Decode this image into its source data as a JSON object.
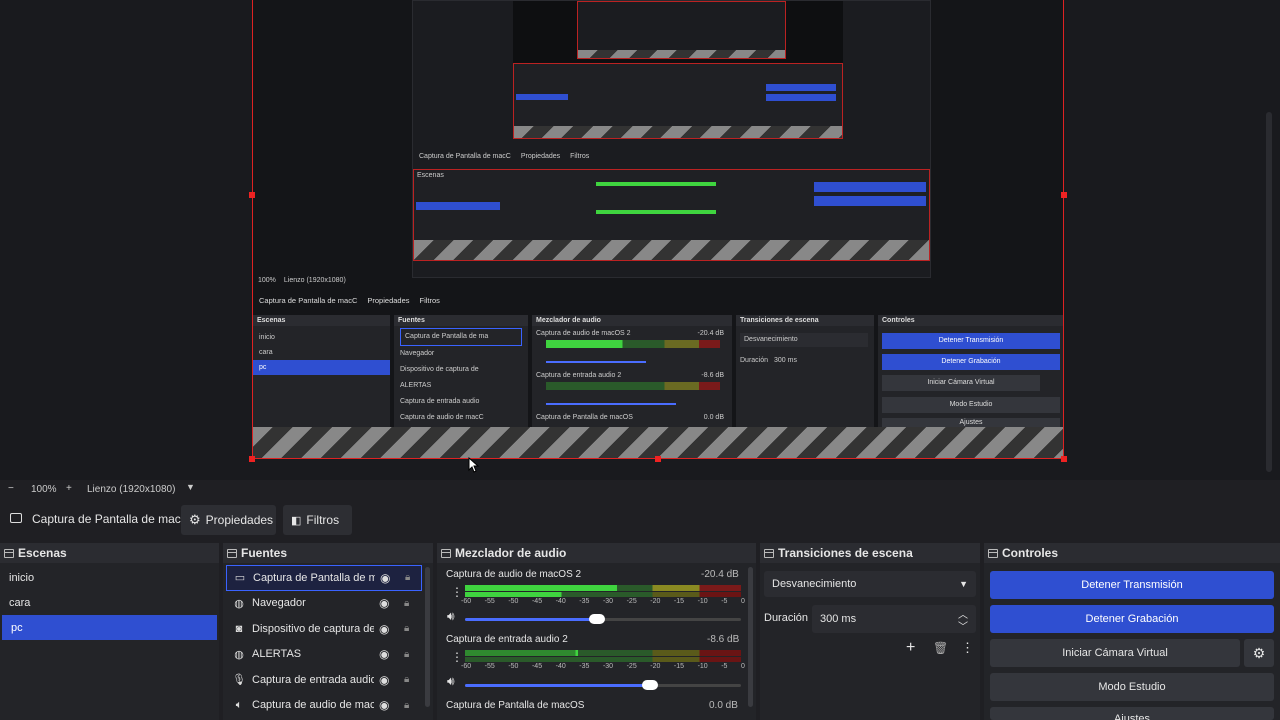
{
  "preview": {
    "zoom": "100%",
    "canvas_label": "Lienzo (1920x1080)",
    "mini": {
      "zoom": "100%",
      "canvas_label": "Lienzo (1920x1080)",
      "source_name": "Captura de Pantalla de macC",
      "props": "Propiedades",
      "filters": "Filtros",
      "scenes_title": "Escenas",
      "scenes": [
        "inicio",
        "cara",
        "pc"
      ],
      "sources_title": "Fuentes",
      "sources": [
        "Captura de Pantalla de ma",
        "Navegador",
        "Dispositivo de captura de",
        "ALERTAS",
        "Captura de entrada audio",
        "Captura de audio de macC"
      ],
      "mixer_title": "Mezclador de audio",
      "mixer": [
        {
          "name": "Captura de audio de macOS 2",
          "db": "-20.4 dB"
        },
        {
          "name": "Captura de entrada audio 2",
          "db": "-8.6 dB"
        },
        {
          "name": "Captura de Pantalla de macOS",
          "db": "0.0 dB"
        }
      ],
      "transitions_title": "Transiciones de escena",
      "transition": "Desvanecimiento",
      "duration_label": "Duración",
      "duration": "300 ms",
      "controls_title": "Controles",
      "controls": [
        "Detener Transmisión",
        "Detener Grabación",
        "Iniciar Cámara Virtual",
        "Modo Estudio",
        "Ajustes"
      ]
    }
  },
  "zoombar": {
    "minus": "−",
    "zoom": "100%",
    "plus": "+",
    "canvas": "Lienzo (1920x1080)"
  },
  "propbar": {
    "source_name": "Captura de Pantalla de macC",
    "properties": "Propiedades",
    "filters": "Filtros"
  },
  "scenes": {
    "title": "Escenas",
    "items": [
      "inicio",
      "cara",
      "pc"
    ],
    "selected": 2
  },
  "sources": {
    "title": "Fuentes",
    "items": [
      {
        "label": "Captura de Pantalla de ma",
        "icon": "monitor-icon"
      },
      {
        "label": "Navegador",
        "icon": "globe-icon"
      },
      {
        "label": "Dispositivo de captura de",
        "icon": "camera-icon"
      },
      {
        "label": "ALERTAS",
        "icon": "globe-icon"
      },
      {
        "label": "Captura de entrada audio",
        "icon": "microphone-icon"
      },
      {
        "label": "Captura de audio de macC",
        "icon": "speaker-icon"
      }
    ]
  },
  "mixer": {
    "title": "Mezclador de audio",
    "ticks": [
      "-60",
      "-55",
      "-50",
      "-45",
      "-40",
      "-35",
      "-30",
      "-25",
      "-20",
      "-15",
      "-10",
      "-5",
      "0"
    ],
    "channels": [
      {
        "name": "Captura de audio de macOS 2",
        "db": "-20.4 dB",
        "volume": 0.48
      },
      {
        "name": "Captura de entrada audio 2",
        "db": "-8.6 dB",
        "volume": 0.67
      },
      {
        "name": "Captura de Pantalla de macOS",
        "db": "0.0 dB"
      }
    ]
  },
  "transitions": {
    "title": "Transiciones de escena",
    "selected": "Desvanecimiento",
    "duration_label": "Duración",
    "duration": "300 ms"
  },
  "controls": {
    "title": "Controles",
    "stop_stream": "Detener Transmisión",
    "stop_record": "Detener Grabación",
    "virtual_cam": "Iniciar Cámara Virtual",
    "studio_mode": "Modo Estudio",
    "settings": "Ajustes"
  },
  "colors": {
    "accent": "#2f4fd1",
    "selection_border": "#dd2222",
    "meter_green": "#3fd43f",
    "meter_yellow": "#a8a822",
    "meter_red": "#c22"
  }
}
